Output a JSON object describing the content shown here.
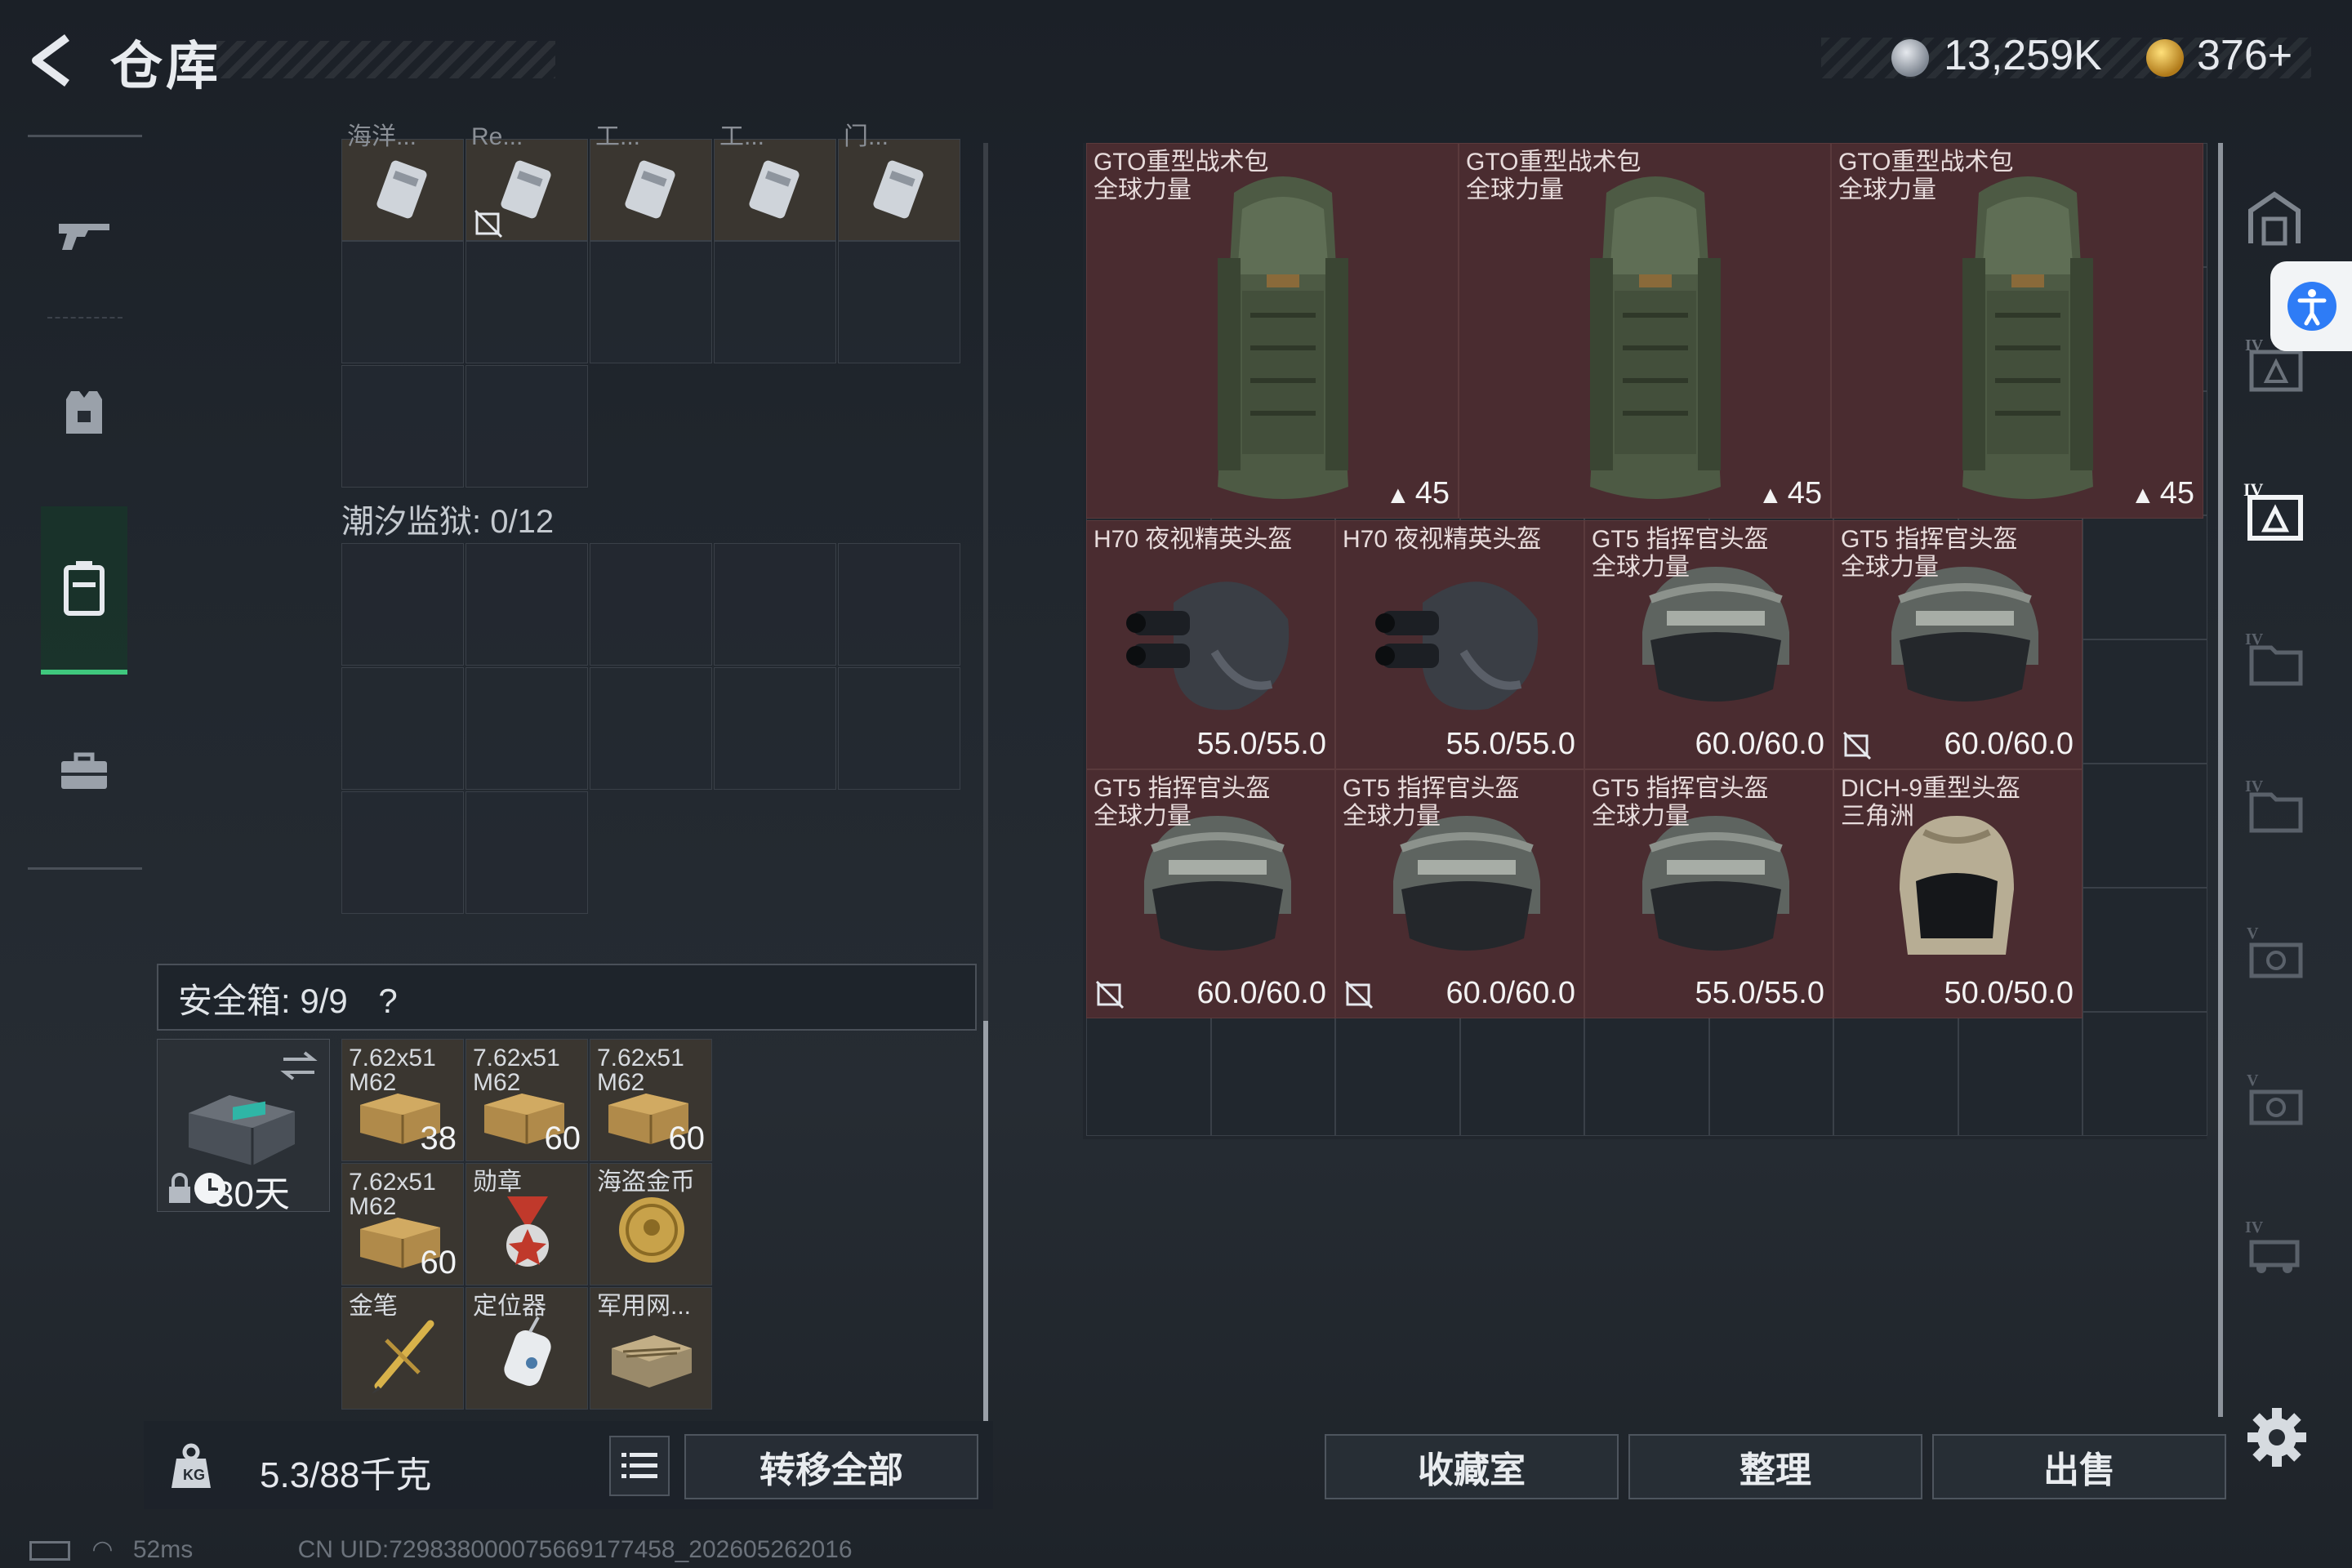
{
  "header": {
    "title": "仓库"
  },
  "currency": {
    "silver": "13,259K",
    "gold": "376+"
  },
  "left_nav": {
    "items": [
      "weapon",
      "armor",
      "backpack",
      "toolbox"
    ]
  },
  "top_cards": [
    "海洋...",
    "Re...",
    "工...",
    "工...",
    "门..."
  ],
  "prison": {
    "label": "潮汐监狱: 0/12"
  },
  "safe": {
    "label": "安全箱: 9/9",
    "help": "?",
    "days": "30天",
    "items": [
      {
        "name": "7.62x51 M62",
        "count": "38"
      },
      {
        "name": "7.62x51 M62",
        "count": "60"
      },
      {
        "name": "7.62x51 M62",
        "count": "60"
      },
      {
        "name": "7.62x51 M62",
        "count": "60"
      },
      {
        "name": "勋章",
        "count": ""
      },
      {
        "name": "海盗金币",
        "count": ""
      },
      {
        "name": "金笔",
        "count": ""
      },
      {
        "name": "定位器",
        "count": ""
      },
      {
        "name": "军用网...",
        "count": ""
      }
    ]
  },
  "weight": {
    "text": "5.3/88千克"
  },
  "buttons": {
    "transfer_all": "转移全部",
    "collection": "收藏室",
    "organize": "整理",
    "sell": "出售"
  },
  "backpacks": [
    {
      "name": "GTO重型战术包",
      "sub": "全球力量",
      "capacity": "45"
    },
    {
      "name": "GTO重型战术包",
      "sub": "全球力量",
      "capacity": "45"
    },
    {
      "name": "GTO重型战术包",
      "sub": "全球力量",
      "capacity": "45"
    }
  ],
  "helmets": [
    {
      "name": "H70 夜视精英头盔",
      "sub": "",
      "durability": "55.0/55.0",
      "type": "nv"
    },
    {
      "name": "H70 夜视精英头盔",
      "sub": "",
      "durability": "55.0/55.0",
      "type": "nv"
    },
    {
      "name": "GT5 指挥官头盔",
      "sub": "全球力量",
      "durability": "60.0/60.0",
      "type": "gt5"
    },
    {
      "name": "GT5 指挥官头盔",
      "sub": "全球力量",
      "durability": "60.0/60.0",
      "type": "gt5"
    },
    {
      "name": "GT5 指挥官头盔",
      "sub": "全球力量",
      "durability": "60.0/60.0",
      "type": "gt5"
    },
    {
      "name": "GT5 指挥官头盔",
      "sub": "全球力量",
      "durability": "60.0/60.0",
      "type": "gt5"
    },
    {
      "name": "GT5 指挥官头盔",
      "sub": "全球力量",
      "durability": "55.0/55.0",
      "type": "gt5"
    },
    {
      "name": "DICH-9重型头盔",
      "sub": "三角洲",
      "durability": "50.0/50.0",
      "type": "dich"
    }
  ],
  "status": {
    "ping": "52ms",
    "uid": "CN UID:729838000075669177458_202605262016"
  }
}
